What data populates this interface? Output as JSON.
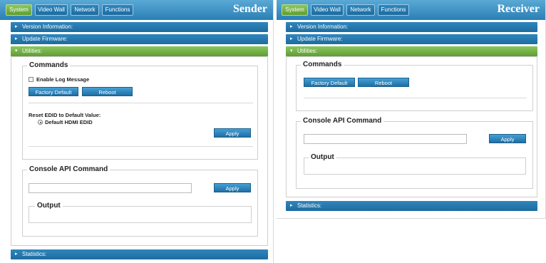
{
  "tabs": [
    "System",
    "Video Wall",
    "Network",
    "Functions"
  ],
  "sender": {
    "title": "Sender",
    "sections": {
      "version": "Version Information:",
      "update": "Update Firmware:",
      "utilities": "Utilities:",
      "statistics": "Statistics:"
    },
    "commands": {
      "legend": "Commands",
      "enable_log": "Enable Log Message",
      "factory_default": "Factory Default",
      "reboot": "Reboot",
      "reset_edid": "Reset EDID to Default Value:",
      "default_hdmi_edid": "Default HDMI EDID",
      "apply": "Apply"
    },
    "console": {
      "legend": "Console API Command",
      "input_value": "",
      "apply": "Apply",
      "output_legend": "Output"
    }
  },
  "receiver": {
    "title": "Receiver",
    "sections": {
      "version": "Version Information:",
      "update": "Update Firmware:",
      "utilities": "Utilities:",
      "statistics": "Statistics:"
    },
    "commands": {
      "legend": "Commands",
      "factory_default": "Factory Default",
      "reboot": "Reboot"
    },
    "console": {
      "legend": "Console API Command",
      "input_value": "",
      "apply": "Apply",
      "output_legend": "Output"
    }
  },
  "colors": {
    "tab_active": "#6fae43",
    "bar_blue": "#2a7fb4",
    "button_blue": "#2f86bd"
  }
}
